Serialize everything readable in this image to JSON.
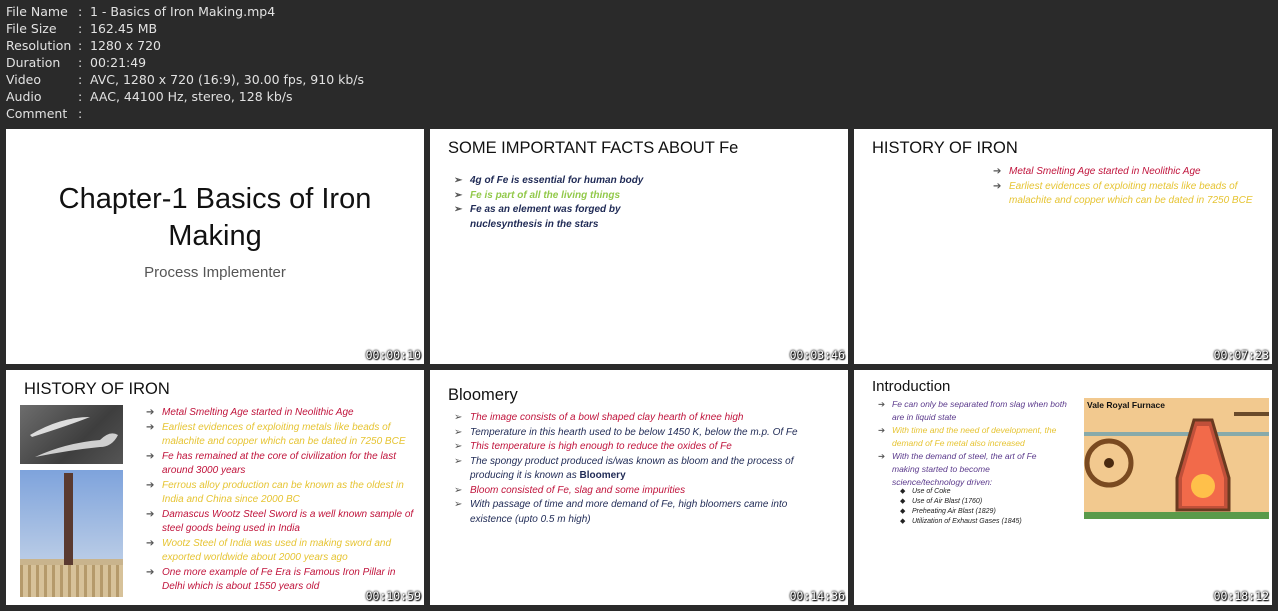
{
  "info": [
    {
      "key": "File Name",
      "value": "1 - Basics of Iron Making.mp4"
    },
    {
      "key": "File Size",
      "value": "162.45 MB"
    },
    {
      "key": "Resolution",
      "value": "1280 x 720"
    },
    {
      "key": "Duration",
      "value": "00:21:49"
    },
    {
      "key": "Video",
      "value": "AVC, 1280 x 720 (16:9), 30.00 fps, 910 kb/s"
    },
    {
      "key": "Audio",
      "value": "AAC, 44100 Hz, stereo, 128 kb/s"
    },
    {
      "key": "Comment",
      "value": ""
    }
  ],
  "separator": ":",
  "thumbs": [
    {
      "timestamp": "00:00:10",
      "title": "Chapter-1 Basics of Iron Making",
      "subtitle": "Process Implementer"
    },
    {
      "timestamp": "00:03:46",
      "title": "SOME IMPORTANT FACTS ABOUT Fe",
      "bullets": [
        "4g of Fe is essential for human body",
        "Fe is part of all the living things",
        "Fe as an element was forged by nuclesynthesis in the stars"
      ]
    },
    {
      "timestamp": "00:07:23",
      "title": "HISTORY OF IRON",
      "bullets": [
        "Metal Smelting Age started in Neolithic Age",
        "Earliest evidences of exploiting metals like beads of malachite and copper which can be dated in 7250 BCE"
      ]
    },
    {
      "timestamp": "00:10:59",
      "title": "HISTORY OF IRON",
      "bullets": [
        "Metal Smelting Age started in Neolithic Age",
        "Earliest evidences of exploiting metals like beads of malachite and copper which can be dated in 7250 BCE",
        "Fe has remained at the core of civilization for the last around 3000 years",
        "Ferrous alloy production can be known as the oldest in India and China since 2000 BC",
        "Damascus Wootz Steel Sword is a well known sample of steel goods being used in India",
        "Wootz Steel of India was used in making sword and exported worldwide about 2000 years ago",
        "One more example of Fe Era is Famous Iron Pillar in Delhi which is about 1550 years old"
      ]
    },
    {
      "timestamp": "00:14:36",
      "title": "Bloomery",
      "bullets": [
        "The image consists of a bowl shaped clay hearth of knee high",
        "Temperature in this hearth used to be below 1450 K, below the m.p. Of Fe",
        "This temperature is high enough to reduce the oxides of Fe",
        "The spongy product produced is/was known as bloom and the process of producing it is known as ",
        "Bloom consisted of Fe, slag and some impurities",
        "With passage of time and more demand of Fe, high bloomers came into existence (upto 0.5 m high)"
      ],
      "bold_term": "Bloomery"
    },
    {
      "timestamp": "00:18:12",
      "title": "Introduction",
      "bullets": [
        "Fe can only be separated from slag when both are in liquid state",
        "With time and the need of development, the demand of Fe metal also increased",
        "With the demand of steel, the art of Fe making started to become science/technology driven:"
      ],
      "sub_bullets": [
        "Use of Coke",
        "Use of Air Blast (1760)",
        "Preheating Air Blast (1829)",
        "Utilization of Exhaust Gases (1845)"
      ],
      "figure_title": "Vale Royal Furnace"
    }
  ]
}
